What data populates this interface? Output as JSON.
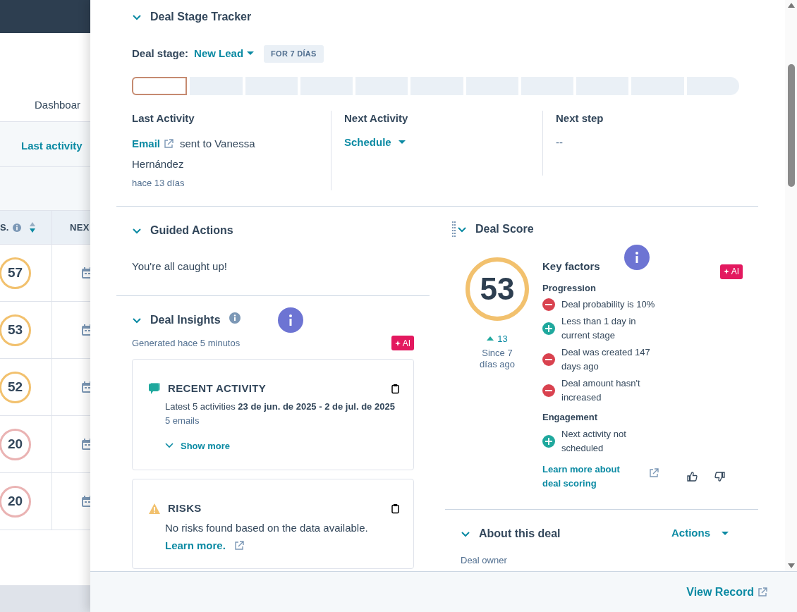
{
  "background": {
    "nav_link": "Dashboar",
    "filter_link": "Last activity",
    "columns": [
      {
        "label": "S."
      },
      {
        "label": "NEX"
      }
    ],
    "rows": [
      {
        "score": "57",
        "color": "#f2c16e"
      },
      {
        "score": "53",
        "color": "#f2c16e"
      },
      {
        "score": "52",
        "color": "#f2c16e"
      },
      {
        "score": "20",
        "color": "#eab3b3"
      },
      {
        "score": "20",
        "color": "#eab3b3"
      }
    ]
  },
  "stage_tracker": {
    "title": "Deal Stage Tracker",
    "expanded": true,
    "stage_label": "Deal stage:",
    "stage_value": "New Lead",
    "duration_badge": "FOR 7 DÍAS",
    "stages": [
      {
        "selected": true
      },
      {
        "selected": false
      },
      {
        "selected": false
      },
      {
        "selected": false
      },
      {
        "selected": false
      },
      {
        "selected": false
      },
      {
        "selected": false
      },
      {
        "selected": false
      },
      {
        "selected": false
      },
      {
        "selected": false
      },
      {
        "selected": false
      }
    ],
    "last_activity": {
      "title": "Last Activity",
      "link": "Email",
      "text": "sent to Vanessa Hernández",
      "time": "hace 13 días"
    },
    "next_activity": {
      "title": "Next Activity",
      "action": "Schedule"
    },
    "next_step": {
      "title": "Next step",
      "value": "--"
    }
  },
  "guided_actions": {
    "title": "Guided Actions",
    "expanded": true,
    "message": "You're all caught up!"
  },
  "deal_insights": {
    "title": "Deal Insights",
    "expanded": true,
    "generated": "Generated hace 5 minutos",
    "badge": "AI",
    "cards": [
      {
        "kind": "activity",
        "title": "RECENT ACTIVITY",
        "text": "Latest 5 activities **23 de jun. de 2025 - 2 de jul. de 2025**",
        "detail": "5 emails",
        "action": "Show more"
      },
      {
        "kind": "risk",
        "title": "RISKS",
        "text": "No risks found based on the data available.",
        "action": "Learn more."
      }
    ]
  },
  "deal_score": {
    "title": "Deal Score",
    "expanded": true,
    "score": "53",
    "change": "13",
    "since": "Since 7 días ago",
    "factors_title": "Key factors",
    "badge": "AI",
    "groups": [
      {
        "title": "Progression",
        "factors": [
          {
            "kind": "negative",
            "text": "Deal probability is 10%"
          },
          {
            "kind": "positive",
            "text": "Less than 1 day in current stage"
          },
          {
            "kind": "negative",
            "text": "Deal was created 147 days ago"
          },
          {
            "kind": "negative",
            "text": "Deal amount hasn't increased"
          }
        ]
      },
      {
        "title": "Engagement",
        "factors": [
          {
            "kind": "positive",
            "text": "Next activity not scheduled"
          }
        ]
      }
    ],
    "learn_more": "Learn more about deal scoring"
  },
  "about": {
    "title": "About this deal",
    "expanded": true,
    "actions": "Actions",
    "first_field": "Deal owner"
  },
  "footer": {
    "link": "View Record"
  }
}
